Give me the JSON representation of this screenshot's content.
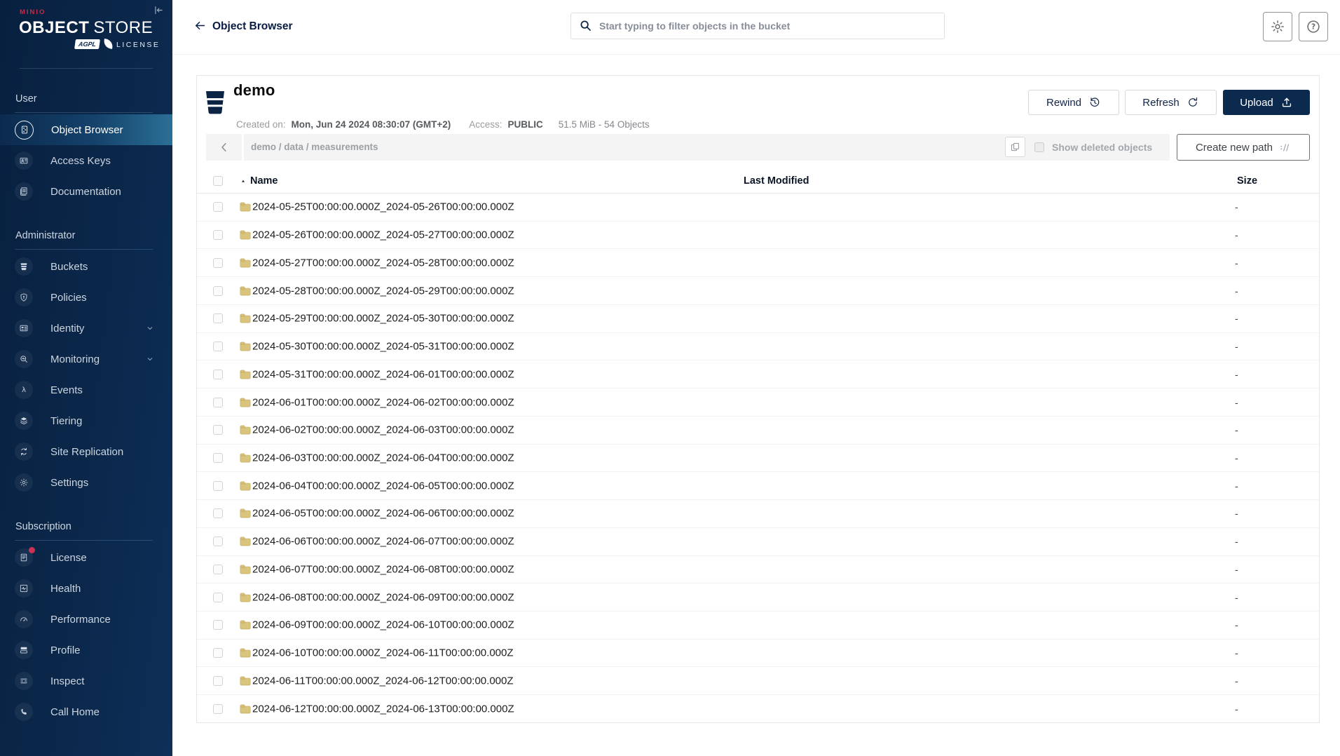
{
  "colors": {
    "brand_red": "#C72C48",
    "navy": "#081C42",
    "sidebar_top": "#082040",
    "sidebar_bottom": "#0E2F58",
    "selected_gradient_end": "#2B6F96",
    "folder": "#D9C47D",
    "bar_bg": "#F4F4F4",
    "upload_bg": "#0C2A4D"
  },
  "sidebar": {
    "logo": {
      "brand": "MINIO",
      "product_bold": "OBJECT",
      "product_light": "STORE",
      "badge": "AGPL",
      "license": "LICENSE"
    },
    "sections": [
      {
        "label": "User",
        "items": [
          {
            "label": "Object Browser",
            "icon": "object-browser",
            "selected": true
          },
          {
            "label": "Access Keys",
            "icon": "access-keys"
          },
          {
            "label": "Documentation",
            "icon": "documentation"
          }
        ]
      },
      {
        "label": "Administrator",
        "items": [
          {
            "label": "Buckets",
            "icon": "buckets"
          },
          {
            "label": "Policies",
            "icon": "policies"
          },
          {
            "label": "Identity",
            "icon": "identity",
            "expandable": true
          },
          {
            "label": "Monitoring",
            "icon": "monitoring",
            "expandable": true
          },
          {
            "label": "Events",
            "icon": "events"
          },
          {
            "label": "Tiering",
            "icon": "tiering"
          },
          {
            "label": "Site Replication",
            "icon": "site-replication"
          },
          {
            "label": "Settings",
            "icon": "settings"
          }
        ]
      },
      {
        "label": "Subscription",
        "items": [
          {
            "label": "License",
            "icon": "license",
            "badge": true
          },
          {
            "label": "Health",
            "icon": "health"
          },
          {
            "label": "Performance",
            "icon": "performance"
          },
          {
            "label": "Profile",
            "icon": "profile"
          },
          {
            "label": "Inspect",
            "icon": "inspect"
          },
          {
            "label": "Call Home",
            "icon": "call-home"
          }
        ]
      }
    ]
  },
  "topbar": {
    "title": "Object Browser",
    "search_placeholder": "Start typing to filter objects in the bucket"
  },
  "icons": {
    "collapse": "collapse-sidebar-icon",
    "back": "back-arrow-icon",
    "search": "search-icon",
    "settings_button": "gear-icon",
    "help_button": "help-icon",
    "rewind": "history-icon",
    "refresh": "refresh-icon",
    "upload": "upload-icon",
    "copy": "copy-icon",
    "breadcrumb_back": "chevron-left-icon",
    "create_path": "new-path-icon",
    "sort": "sort-ascending-icon",
    "folder": "folder-icon",
    "bucket": "bucket-icon"
  },
  "bucket": {
    "name": "demo",
    "created_label": "Created on:",
    "created_value": "Mon, Jun 24 2024 08:30:07 (GMT+2)",
    "access_label": "Access:",
    "access_value": "PUBLIC",
    "usage": "51.5 MiB - 54 Objects",
    "rewind_label": "Rewind",
    "refresh_label": "Refresh",
    "upload_label": "Upload"
  },
  "browser": {
    "breadcrumb": "demo / data / measurements",
    "show_deleted_label": "Show deleted objects",
    "show_deleted_checked": false,
    "create_path_label": "Create new path"
  },
  "table": {
    "sort_column": "Name",
    "sort_direction": "asc",
    "columns": [
      {
        "key": "name",
        "label": "Name"
      },
      {
        "key": "last_modified",
        "label": "Last Modified"
      },
      {
        "key": "size",
        "label": "Size"
      }
    ],
    "rows": [
      {
        "name": "2024-05-25T00:00:00.000Z_2024-05-26T00:00:00.000Z",
        "last_modified": "",
        "size": "-"
      },
      {
        "name": "2024-05-26T00:00:00.000Z_2024-05-27T00:00:00.000Z",
        "last_modified": "",
        "size": "-"
      },
      {
        "name": "2024-05-27T00:00:00.000Z_2024-05-28T00:00:00.000Z",
        "last_modified": "",
        "size": "-"
      },
      {
        "name": "2024-05-28T00:00:00.000Z_2024-05-29T00:00:00.000Z",
        "last_modified": "",
        "size": "-"
      },
      {
        "name": "2024-05-29T00:00:00.000Z_2024-05-30T00:00:00.000Z",
        "last_modified": "",
        "size": "-"
      },
      {
        "name": "2024-05-30T00:00:00.000Z_2024-05-31T00:00:00.000Z",
        "last_modified": "",
        "size": "-"
      },
      {
        "name": "2024-05-31T00:00:00.000Z_2024-06-01T00:00:00.000Z",
        "last_modified": "",
        "size": "-"
      },
      {
        "name": "2024-06-01T00:00:00.000Z_2024-06-02T00:00:00.000Z",
        "last_modified": "",
        "size": "-"
      },
      {
        "name": "2024-06-02T00:00:00.000Z_2024-06-03T00:00:00.000Z",
        "last_modified": "",
        "size": "-"
      },
      {
        "name": "2024-06-03T00:00:00.000Z_2024-06-04T00:00:00.000Z",
        "last_modified": "",
        "size": "-"
      },
      {
        "name": "2024-06-04T00:00:00.000Z_2024-06-05T00:00:00.000Z",
        "last_modified": "",
        "size": "-"
      },
      {
        "name": "2024-06-05T00:00:00.000Z_2024-06-06T00:00:00.000Z",
        "last_modified": "",
        "size": "-"
      },
      {
        "name": "2024-06-06T00:00:00.000Z_2024-06-07T00:00:00.000Z",
        "last_modified": "",
        "size": "-"
      },
      {
        "name": "2024-06-07T00:00:00.000Z_2024-06-08T00:00:00.000Z",
        "last_modified": "",
        "size": "-"
      },
      {
        "name": "2024-06-08T00:00:00.000Z_2024-06-09T00:00:00.000Z",
        "last_modified": "",
        "size": "-"
      },
      {
        "name": "2024-06-09T00:00:00.000Z_2024-06-10T00:00:00.000Z",
        "last_modified": "",
        "size": "-"
      },
      {
        "name": "2024-06-10T00:00:00.000Z_2024-06-11T00:00:00.000Z",
        "last_modified": "",
        "size": "-"
      },
      {
        "name": "2024-06-11T00:00:00.000Z_2024-06-12T00:00:00.000Z",
        "last_modified": "",
        "size": "-"
      },
      {
        "name": "2024-06-12T00:00:00.000Z_2024-06-13T00:00:00.000Z",
        "last_modified": "",
        "size": "-"
      }
    ]
  }
}
